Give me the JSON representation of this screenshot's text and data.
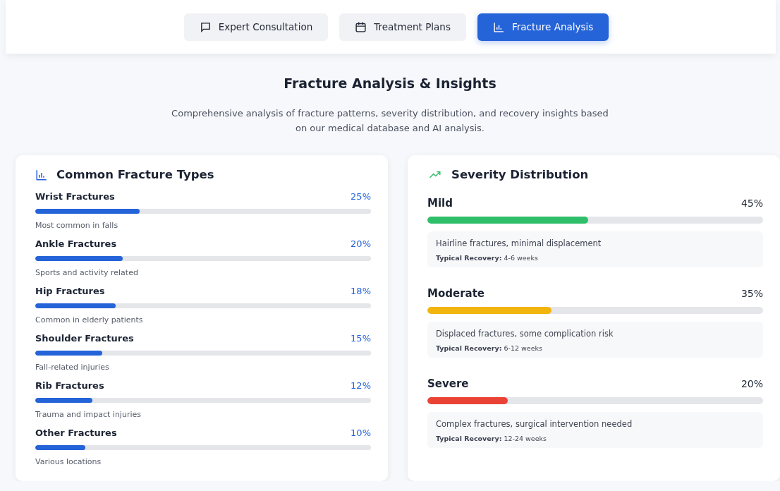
{
  "tabs": [
    {
      "label": "Expert Consultation",
      "selected": false
    },
    {
      "label": "Treatment Plans",
      "selected": false
    },
    {
      "label": "Fracture Analysis",
      "selected": true
    }
  ],
  "header": {
    "title": "Fracture Analysis & Insights",
    "description": "Comprehensive analysis of fracture patterns, severity distribution, and recovery insights based on our medical database and AI analysis."
  },
  "fracture_types": {
    "title": "Common Fracture Types",
    "items": [
      {
        "name": "Wrist Fractures",
        "percent": "25%",
        "level": 0.31,
        "note": "Most common in falls"
      },
      {
        "name": "Ankle Fractures",
        "percent": "20%",
        "level": 0.26,
        "note": "Sports and activity related"
      },
      {
        "name": "Hip Fractures",
        "percent": "18%",
        "level": 0.24,
        "note": "Common in elderly patients"
      },
      {
        "name": "Shoulder Fractures",
        "percent": "15%",
        "level": 0.2,
        "note": "Fall-related injuries"
      },
      {
        "name": "Rib Fractures",
        "percent": "12%",
        "level": 0.17,
        "note": "Trauma and impact injuries"
      },
      {
        "name": "Other Fractures",
        "percent": "10%",
        "level": 0.15,
        "note": "Various locations"
      }
    ]
  },
  "severity": {
    "title": "Severity Distribution",
    "items": [
      {
        "name": "Mild",
        "percent": "45%",
        "level": 0.48,
        "color": "#2fbf6a",
        "description": "Hairline fractures, minimal displacement",
        "recovery": "**Typical Recovery:** 4-6 weeks"
      },
      {
        "name": "Moderate",
        "percent": "35%",
        "level": 0.37,
        "color": "#f2b50f",
        "description": "Displaced fractures, some complication risk",
        "recovery": "**Typical Recovery:** 6-12 weeks"
      },
      {
        "name": "Severe",
        "percent": "20%",
        "level": 0.24,
        "color": "#ea4335",
        "description": "Complex fractures, surgical intervention needed",
        "recovery": "**Typical Recovery:** 12-24 weeks"
      }
    ]
  }
}
